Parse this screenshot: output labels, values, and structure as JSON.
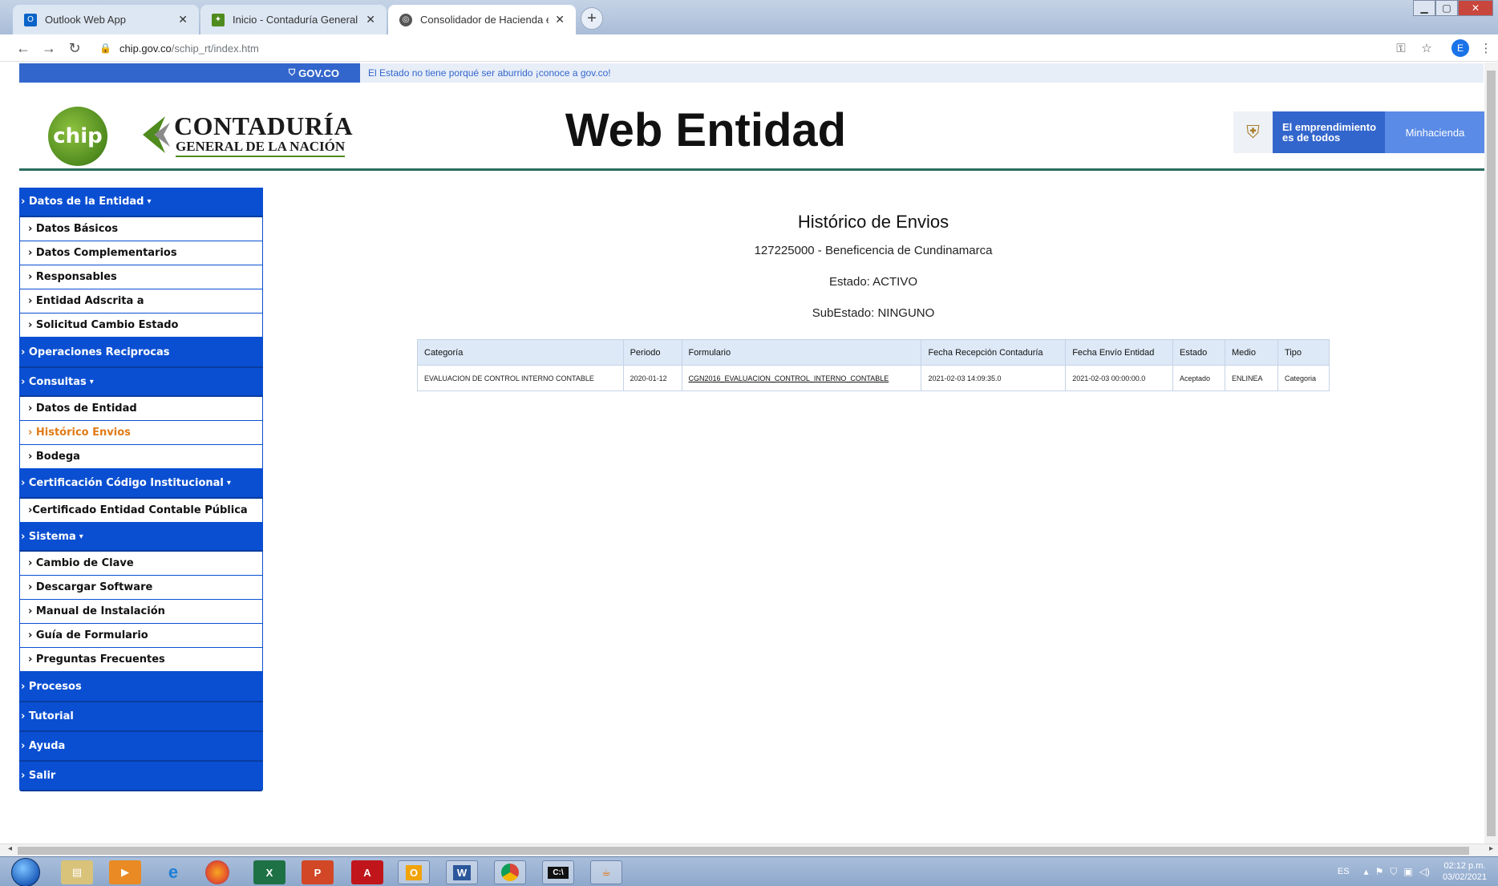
{
  "browser": {
    "tabs": [
      {
        "title": "Outlook Web App",
        "favicon": "outlook-icon",
        "active": false
      },
      {
        "title": "Inicio - Contaduría General de la",
        "favicon": "cgn-favicon",
        "active": false
      },
      {
        "title": "Consolidador de Hacienda e Info",
        "favicon": "globe-icon",
        "active": true
      }
    ],
    "url_host": "chip.gov.co",
    "url_path": "/schip_rt/index.htm",
    "profile_initial": "E"
  },
  "gov_bar": {
    "logo": "GOV.CO",
    "text": "El Estado no tiene porqué ser aburrido ¡conoce a gov.co!"
  },
  "header": {
    "chip_logo": "chip",
    "cgn_line1": "CONTADURÍA",
    "cgn_line2": "GENERAL DE LA NACIÓN",
    "app_title": "Web Entidad",
    "slogan_line1": "El emprendimiento",
    "slogan_line2": "es de todos",
    "ministry": "Minhacienda"
  },
  "sidebar": {
    "sections": [
      {
        "label": "› Datos de la Entidad",
        "caret": "▾",
        "items": [
          "› Datos Básicos",
          "› Datos Complementarios",
          "› Responsables",
          "› Entidad Adscrita a",
          "› Solicitud Cambio Estado"
        ]
      },
      {
        "label": "› Operaciones Reciprocas",
        "caret": "",
        "items": []
      },
      {
        "label": "› Consultas",
        "caret": "▾",
        "items": [
          "› Datos de Entidad",
          "› Histórico Envios",
          "› Bodega"
        ]
      },
      {
        "label": "› Certificación Código Institucional",
        "caret": "▾",
        "items": [
          "›Certificado Entidad Contable Pública"
        ]
      },
      {
        "label": "› Sistema",
        "caret": "▾",
        "items": [
          "› Cambio de Clave",
          "› Descargar Software",
          "› Manual de Instalación",
          "› Guía de Formulario",
          "› Preguntas Frecuentes"
        ]
      },
      {
        "label": "› Procesos",
        "caret": "",
        "items": []
      },
      {
        "label": "› Tutorial",
        "caret": "",
        "items": []
      },
      {
        "label": "› Ayuda",
        "caret": "",
        "items": []
      },
      {
        "label": "› Salir",
        "caret": "",
        "items": []
      }
    ],
    "active_item": "› Histórico Envios"
  },
  "main": {
    "title": "Histórico de Envios",
    "entity": "127225000 - Beneficencia de Cundinamarca",
    "estado": "Estado: ACTIVO",
    "subestado": "SubEstado: NINGUNO",
    "table": {
      "headers": [
        "Categoría",
        "Periodo",
        "Formulario",
        "Fecha Recepción Contaduría",
        "Fecha Envío Entidad",
        "Estado",
        "Medio",
        "Tipo"
      ],
      "rows": [
        [
          "EVALUACION DE CONTROL INTERNO CONTABLE",
          "2020-01-12",
          "CGN2016_EVALUACION_CONTROL_INTERNO_CONTABLE",
          "2021-02-03 14:09:35.0",
          "2021-02-03 00:00:00.0",
          "Aceptado",
          "ENLINEA",
          "Categoria"
        ]
      ]
    }
  },
  "taskbar": {
    "apps": [
      "windows-explorer-icon",
      "media-player-icon",
      "internet-explorer-icon",
      "firefox-icon",
      "excel-icon",
      "powerpoint-icon",
      "acrobat-icon",
      "outlook-icon",
      "word-icon",
      "chrome-icon",
      "cmd-icon",
      "java-icon"
    ],
    "lang": "ES",
    "time": "02:12 p.m.",
    "date": "03/02/2021"
  },
  "colors": {
    "gov_blue": "#3366cc",
    "sidebar_blue": "#0a4fd2",
    "active_orange": "#e07b16",
    "header_line": "#2a6e5f"
  }
}
